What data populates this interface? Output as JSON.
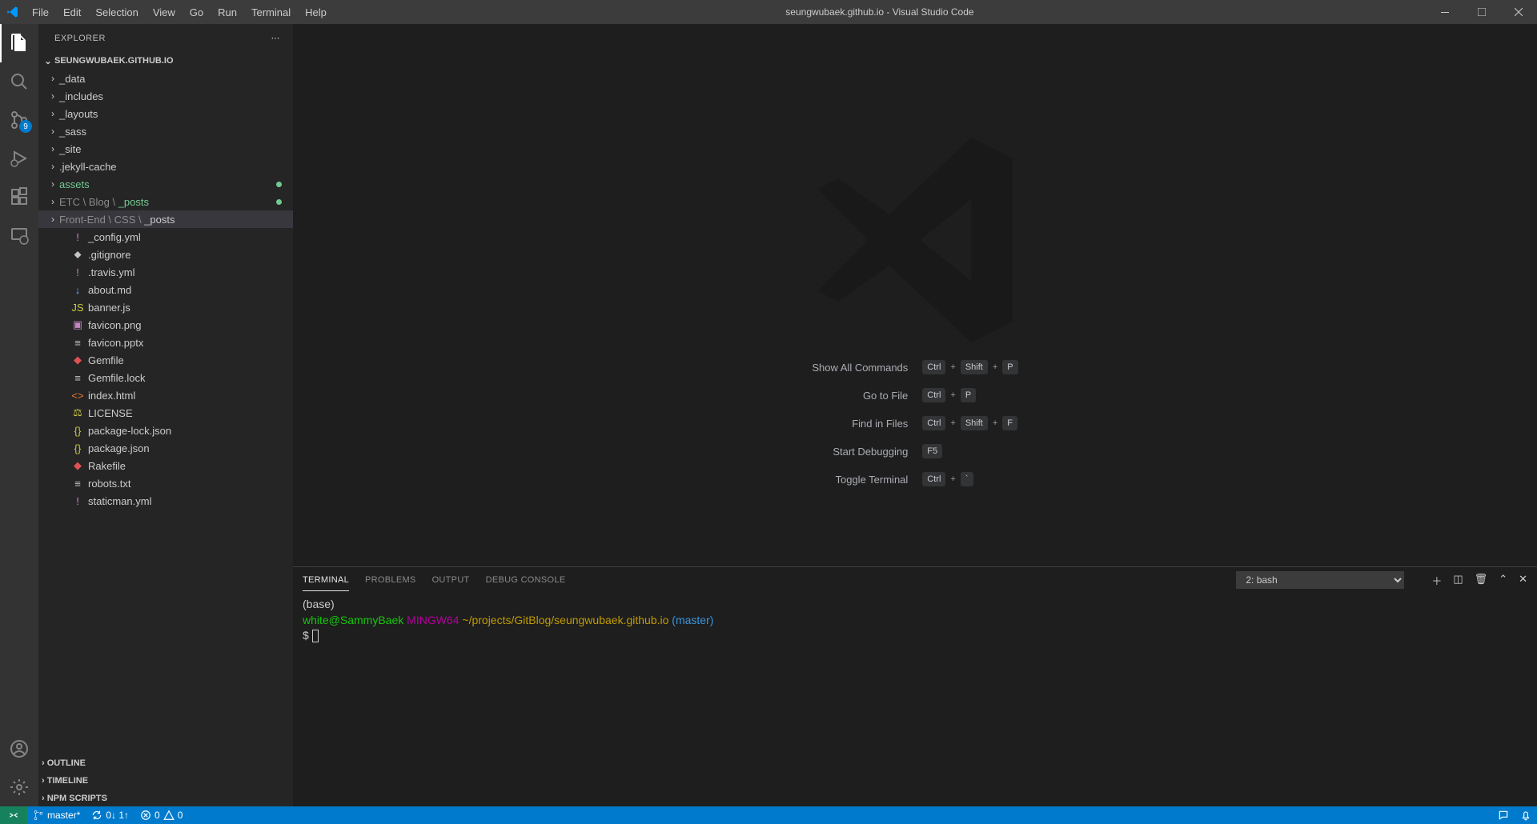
{
  "window": {
    "title": "seungwubaek.github.io - Visual Studio Code"
  },
  "menu": [
    "File",
    "Edit",
    "Selection",
    "View",
    "Go",
    "Run",
    "Terminal",
    "Help"
  ],
  "activitybar": {
    "scm_badge": "9"
  },
  "explorer": {
    "title": "EXPLORER",
    "root": "SEUNGWUBAEK.GITHUB.IO",
    "folders": [
      {
        "name": "_data"
      },
      {
        "name": "_includes"
      },
      {
        "name": "_layouts"
      },
      {
        "name": "_sass"
      },
      {
        "name": "_site"
      },
      {
        "name": ".jekyll-cache"
      },
      {
        "name": "assets",
        "modified": true
      },
      {
        "name": "ETC \\ Blog \\ _posts",
        "modified": true
      },
      {
        "name": "Front-End \\ CSS \\ _posts",
        "selected": true
      }
    ],
    "files": [
      {
        "name": "_config.yml",
        "icon": "!",
        "ic": "ic-purple"
      },
      {
        "name": ".gitignore",
        "icon": "⬥",
        "ic": "ic-txt"
      },
      {
        "name": ".travis.yml",
        "icon": "!",
        "ic": "ic-purple"
      },
      {
        "name": "about.md",
        "icon": "↓",
        "ic": "ic-blue"
      },
      {
        "name": "banner.js",
        "icon": "JS",
        "ic": "ic-js"
      },
      {
        "name": "favicon.png",
        "icon": "▣",
        "ic": "ic-purple"
      },
      {
        "name": "favicon.pptx",
        "icon": "≡",
        "ic": "ic-txt"
      },
      {
        "name": "Gemfile",
        "icon": "◆",
        "ic": "ic-red"
      },
      {
        "name": "Gemfile.lock",
        "icon": "≡",
        "ic": "ic-txt"
      },
      {
        "name": "index.html",
        "icon": "<>",
        "ic": "ic-orange"
      },
      {
        "name": "LICENSE",
        "icon": "⚖",
        "ic": "ic-license"
      },
      {
        "name": "package-lock.json",
        "icon": "{}",
        "ic": "ic-json"
      },
      {
        "name": "package.json",
        "icon": "{}",
        "ic": "ic-json"
      },
      {
        "name": "Rakefile",
        "icon": "◆",
        "ic": "ic-red"
      },
      {
        "name": "robots.txt",
        "icon": "≡",
        "ic": "ic-txt"
      },
      {
        "name": "staticman.yml",
        "icon": "!",
        "ic": "ic-purple"
      }
    ],
    "sections": {
      "outline": "OUTLINE",
      "timeline": "TIMELINE",
      "npm": "NPM SCRIPTS"
    }
  },
  "welcome": {
    "shortcuts": [
      {
        "label": "Show All Commands",
        "keys": [
          "Ctrl",
          "+",
          "Shift",
          "+",
          "P"
        ]
      },
      {
        "label": "Go to File",
        "keys": [
          "Ctrl",
          "+",
          "P"
        ]
      },
      {
        "label": "Find in Files",
        "keys": [
          "Ctrl",
          "+",
          "Shift",
          "+",
          "F"
        ]
      },
      {
        "label": "Start Debugging",
        "keys": [
          "F5"
        ]
      },
      {
        "label": "Toggle Terminal",
        "keys": [
          "Ctrl",
          "+",
          "`"
        ]
      }
    ]
  },
  "panel": {
    "tabs": {
      "terminal": "TERMINAL",
      "problems": "PROBLEMS",
      "output": "OUTPUT",
      "debug": "DEBUG CONSOLE"
    },
    "select": "2: bash",
    "terminal": {
      "line1": "(base)",
      "user": "white@SammyBaek",
      "host": "MINGW64",
      "path": "~/projects/GitBlog/seungwubaek.github.io",
      "branch": "(master)",
      "prompt": "$"
    }
  },
  "status": {
    "branch": "master*",
    "sync": "0↓ 1↑",
    "errors": "0",
    "warnings": "0"
  }
}
